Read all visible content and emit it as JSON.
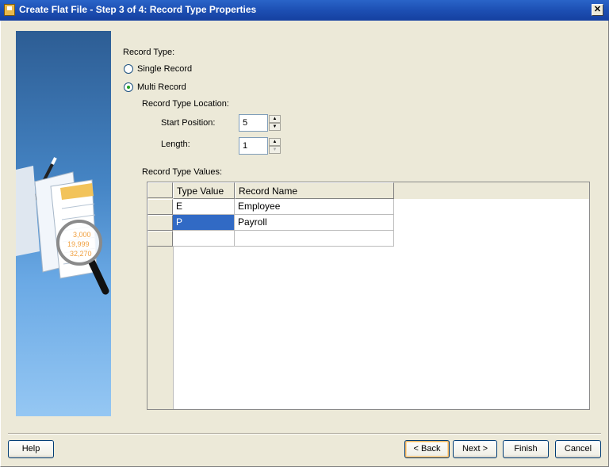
{
  "window": {
    "title": "Create Flat File - Step 3 of 4: Record Type Properties",
    "close_label": "✕"
  },
  "record_type": {
    "heading": "Record Type:",
    "options": [
      {
        "label": "Single Record",
        "checked": false
      },
      {
        "label": "Multi Record",
        "checked": true
      }
    ]
  },
  "location": {
    "heading": "Record Type Location:",
    "start_position": {
      "label": "Start Position:",
      "value": "5"
    },
    "length": {
      "label": "Length:",
      "value": "1"
    }
  },
  "values": {
    "heading": "Record Type Values:",
    "columns": [
      "Type Value",
      "Record Name"
    ],
    "rows": [
      [
        "E",
        "Employee"
      ],
      [
        "P",
        "Payroll"
      ],
      [
        "",
        ""
      ]
    ],
    "selected_cell": "P"
  },
  "buttons": {
    "help": "Help",
    "back": "< Back",
    "next": "Next >",
    "finish": "Finish",
    "cancel": "Cancel"
  },
  "illustration": {
    "numbers": [
      "3,000",
      "19,999",
      "32,270"
    ]
  },
  "colors": {
    "title_bar": "#1d4fb3",
    "selection": "#316ac5",
    "radio_dot": "#21a121"
  }
}
